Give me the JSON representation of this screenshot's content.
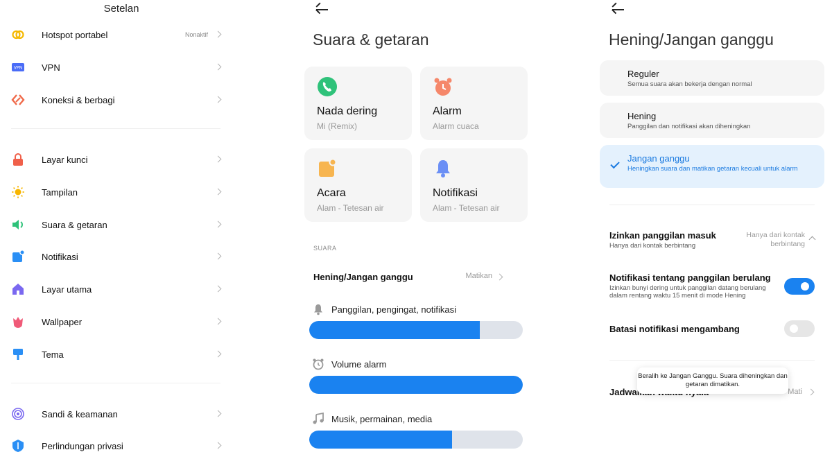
{
  "colors": {
    "accent": "#1a82f0",
    "card_bg": "#f5f5f5",
    "selected_bg": "#e4f1fd"
  },
  "settings": {
    "title": "Setelan",
    "items": [
      {
        "label": "Hotspot portabel",
        "value": "Nonaktif",
        "icon": "hotspot-icon"
      },
      {
        "label": "VPN",
        "icon": "vpn-icon"
      },
      {
        "label": "Koneksi & berbagi",
        "icon": "connection-icon"
      },
      {
        "label": "Layar kunci",
        "icon": "lock-icon"
      },
      {
        "label": "Tampilan",
        "icon": "sun-icon"
      },
      {
        "label": "Suara & getaran",
        "icon": "speaker-icon"
      },
      {
        "label": "Notifikasi",
        "icon": "notification-icon"
      },
      {
        "label": "Layar utama",
        "icon": "home-icon"
      },
      {
        "label": "Wallpaper",
        "icon": "wallpaper-icon"
      },
      {
        "label": "Tema",
        "icon": "theme-icon"
      },
      {
        "label": "Sandi & keamanan",
        "icon": "fingerprint-icon"
      },
      {
        "label": "Perlindungan privasi",
        "icon": "privacy-icon"
      }
    ],
    "vpn_badge": "VPN"
  },
  "sound": {
    "title": "Suara & getaran",
    "cards": [
      {
        "title": "Nada dering",
        "subtitle": "Mi (Remix)",
        "icon": "phone-icon"
      },
      {
        "title": "Alarm",
        "subtitle": "Alarm cuaca",
        "icon": "alarm-icon"
      },
      {
        "title": "Acara",
        "subtitle": "Alam - Tetesan air",
        "icon": "event-icon"
      },
      {
        "title": "Notifikasi",
        "subtitle": "Alam - Tetesan air",
        "icon": "bell-icon"
      }
    ],
    "section_label": "SUARA",
    "dnd_row": {
      "label": "Hening/Jangan ganggu",
      "value": "Matikan"
    },
    "volumes": [
      {
        "label": "Panggilan, pengingat, notifikasi",
        "level": 0.8,
        "icon": "bell-icon"
      },
      {
        "label": "Volume alarm",
        "level": 1.0,
        "icon": "alarm-icon"
      },
      {
        "label": "Musik, permainan, media",
        "level": 0.67,
        "icon": "music-icon"
      }
    ]
  },
  "dnd": {
    "title": "Hening/Jangan ganggu",
    "options": [
      {
        "title": "Reguler",
        "subtitle": "Semua suara akan bekerja dengan normal",
        "selected": false
      },
      {
        "title": "Hening",
        "subtitle": "Panggilan dan notifikasi akan diheningkan",
        "selected": false
      },
      {
        "title": "Jangan ganggu",
        "subtitle": "Heningkan suara dan matikan getaran kecuali untuk alarm",
        "selected": true
      }
    ],
    "allow_calls": {
      "title": "Izinkan panggilan masuk",
      "subtitle": "Hanya dari kontak berbintang",
      "value": "Hanya dari kontak berbintang"
    },
    "repeat_calls": {
      "title": "Notifikasi tentang panggilan berulang",
      "subtitle": "Izinkan bunyi dering untuk panggilan datang berulang dalam rentang waktu 15 menit di mode Hening",
      "enabled": true
    },
    "floating": {
      "title": "Batasi notifikasi mengambang",
      "enabled": false
    },
    "schedule": {
      "title": "Jadwalkan waktu hyala",
      "value": "Mati"
    },
    "toast": "Beralih ke Jangan Ganggu. Suara diheningkan dan getaran dimatikan."
  }
}
